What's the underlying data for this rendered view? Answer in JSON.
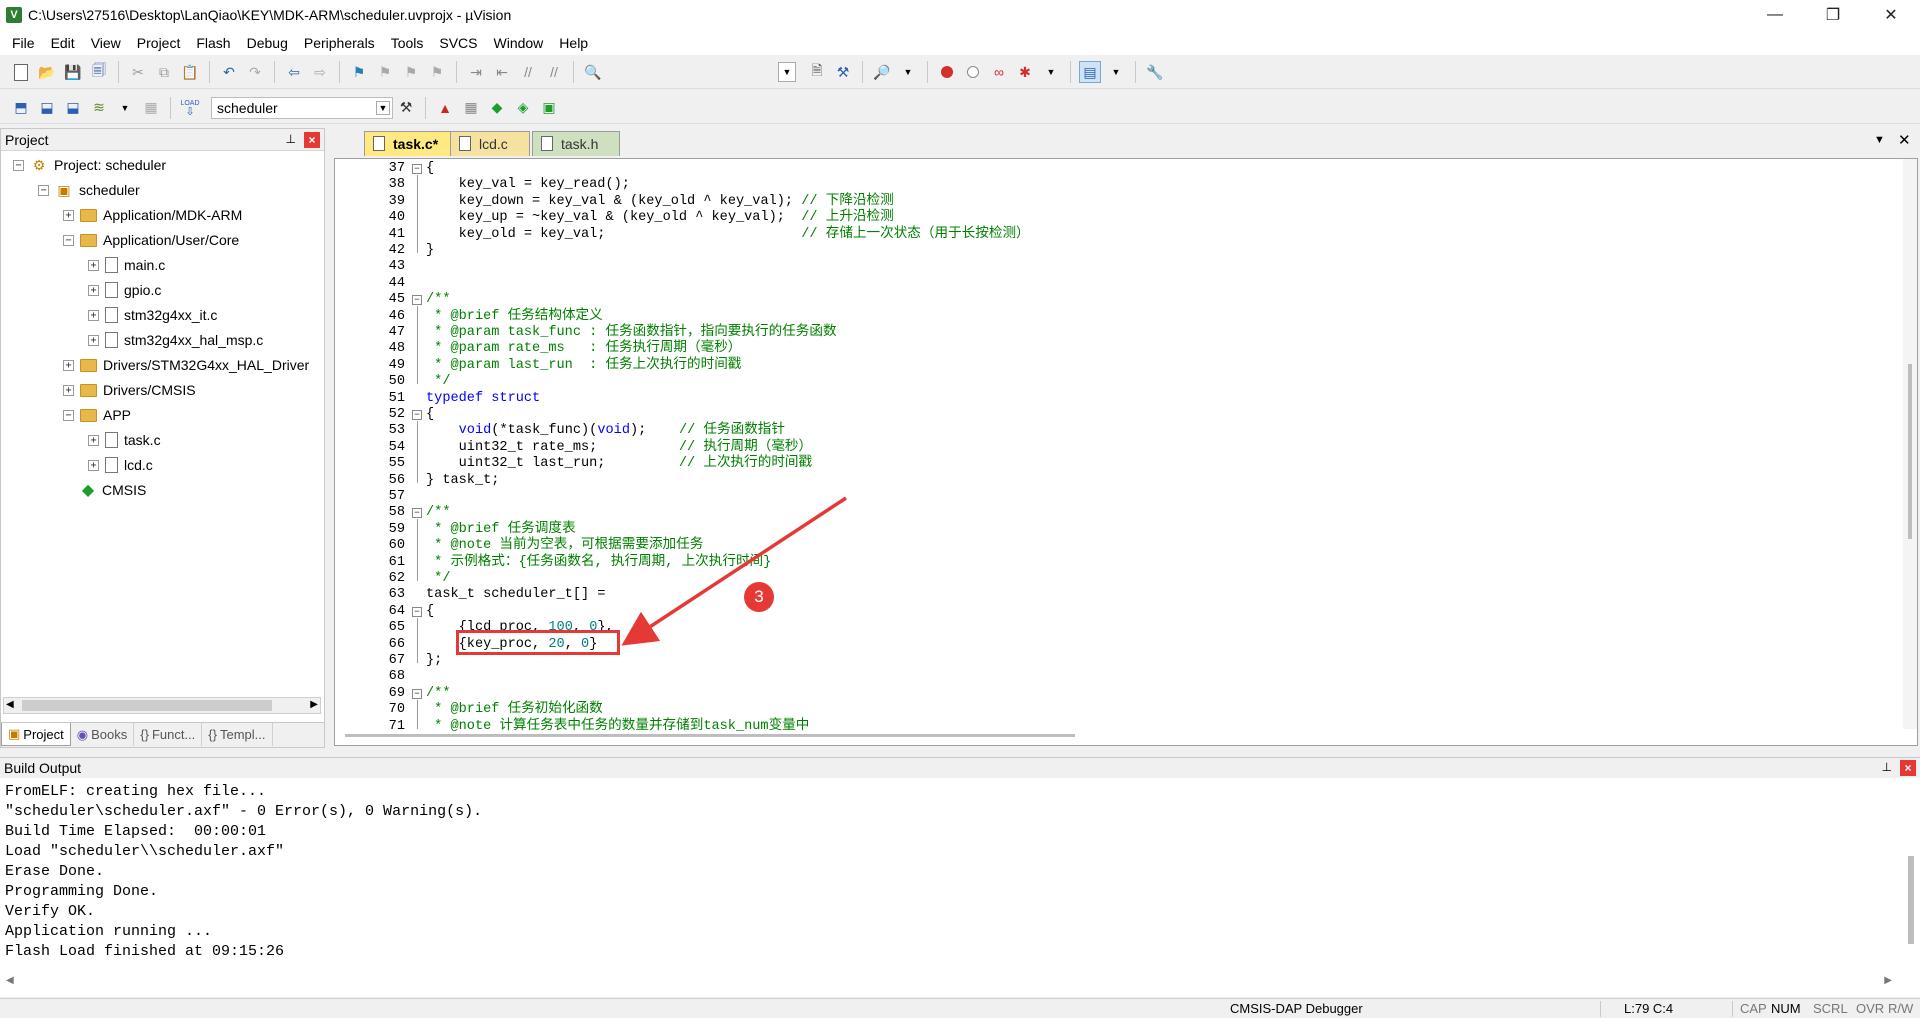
{
  "window": {
    "title": "C:\\Users\\27516\\Desktop\\LanQiao\\KEY\\MDK-ARM\\scheduler.uvprojx - µVision",
    "minimize": "—",
    "maximize": "❐",
    "close": "✕"
  },
  "menu": [
    "File",
    "Edit",
    "View",
    "Project",
    "Flash",
    "Debug",
    "Peripherals",
    "Tools",
    "SVCS",
    "Window",
    "Help"
  ],
  "toolbar2": {
    "target": "scheduler",
    "load_label": "LOAD"
  },
  "project_panel": {
    "title": "Project",
    "pin": "📌",
    "close": "✕",
    "tree": [
      {
        "label": "Project: scheduler",
        "level": 0,
        "expander": "−",
        "icon": "project-icon"
      },
      {
        "label": "scheduler",
        "level": 1,
        "expander": "−",
        "icon": "target-icon"
      },
      {
        "label": "Application/MDK-ARM",
        "level": 2,
        "expander": "+",
        "icon": "folder-icon"
      },
      {
        "label": "Application/User/Core",
        "level": 2,
        "expander": "−",
        "icon": "folder-icon"
      },
      {
        "label": "main.c",
        "level": 3,
        "expander": "+",
        "icon": "file-icon"
      },
      {
        "label": "gpio.c",
        "level": 3,
        "expander": "+",
        "icon": "file-icon"
      },
      {
        "label": "stm32g4xx_it.c",
        "level": 3,
        "expander": "+",
        "icon": "file-icon"
      },
      {
        "label": "stm32g4xx_hal_msp.c",
        "level": 3,
        "expander": "+",
        "icon": "file-icon"
      },
      {
        "label": "Drivers/STM32G4xx_HAL_Driver",
        "level": 2,
        "expander": "+",
        "icon": "folder-icon"
      },
      {
        "label": "Drivers/CMSIS",
        "level": 2,
        "expander": "+",
        "icon": "folder-icon"
      },
      {
        "label": "APP",
        "level": 2,
        "expander": "−",
        "icon": "folder-icon"
      },
      {
        "label": "task.c",
        "level": 3,
        "expander": "+",
        "icon": "file-icon"
      },
      {
        "label": "lcd.c",
        "level": 3,
        "expander": "+",
        "icon": "file-icon"
      },
      {
        "label": "CMSIS",
        "level": 2,
        "expander": "",
        "icon": "cmsis-icon"
      }
    ],
    "tabs": [
      {
        "label": "Project",
        "icon": "project-tab-icon",
        "active": true
      },
      {
        "label": "Books",
        "icon": "books-icon",
        "active": false
      },
      {
        "label": "Funct...",
        "icon": "functions-icon",
        "active": false
      },
      {
        "label": "Templ...",
        "icon": "templates-icon",
        "active": false
      }
    ]
  },
  "editor": {
    "tabs": [
      {
        "label": "task.c*",
        "active": true
      },
      {
        "label": "lcd.c",
        "active": false
      },
      {
        "label": "task.h",
        "active": false
      }
    ],
    "lines": [
      {
        "n": "37",
        "fold": "−",
        "code": "{"
      },
      {
        "n": "38",
        "fold": "",
        "code": "    key_val = key_read();"
      },
      {
        "n": "39",
        "fold": "",
        "code": "    key_down = key_val & (key_old ^ key_val); ",
        "comment": "// 下降沿检测"
      },
      {
        "n": "40",
        "fold": "",
        "code": "    key_up = ~key_val & (key_old ^ key_val);  ",
        "comment": "// 上升沿检测"
      },
      {
        "n": "41",
        "fold": "",
        "code": "    key_old = key_val;                        ",
        "comment": "// 存储上一次状态（用于长按检测）"
      },
      {
        "n": "42",
        "fold": "",
        "code": "}"
      },
      {
        "n": "43",
        "fold": "",
        "code": ""
      },
      {
        "n": "44",
        "fold": "",
        "code": ""
      },
      {
        "n": "45",
        "fold": "−",
        "code": "",
        "comment": "/**"
      },
      {
        "n": "46",
        "fold": "",
        "code": "",
        "comment": " * @brief 任务结构体定义"
      },
      {
        "n": "47",
        "fold": "",
        "code": "",
        "comment": " * @param task_func : 任务函数指针，指向要执行的任务函数"
      },
      {
        "n": "48",
        "fold": "",
        "code": "",
        "comment": " * @param rate_ms   : 任务执行周期（毫秒）"
      },
      {
        "n": "49",
        "fold": "",
        "code": "",
        "comment": " * @param last_run  : 任务上次执行的时间戳"
      },
      {
        "n": "50",
        "fold": "",
        "code": "",
        "comment": " */"
      },
      {
        "n": "51",
        "fold": "",
        "code": "",
        "keyword": "typedef struct"
      },
      {
        "n": "52",
        "fold": "−",
        "code": "{"
      },
      {
        "n": "53",
        "fold": "",
        "code": "    void(*task_func)(void);    ",
        "comment": "// 任务函数指针"
      },
      {
        "n": "54",
        "fold": "",
        "code": "    uint32_t rate_ms;          ",
        "comment": "// 执行周期（毫秒）"
      },
      {
        "n": "55",
        "fold": "",
        "code": "    uint32_t last_run;         ",
        "comment": "// 上次执行的时间戳"
      },
      {
        "n": "56",
        "fold": "",
        "code": "} task_t;"
      },
      {
        "n": "57",
        "fold": "",
        "code": ""
      },
      {
        "n": "58",
        "fold": "−",
        "code": "",
        "comment": "/**"
      },
      {
        "n": "59",
        "fold": "",
        "code": "",
        "comment": " * @brief 任务调度表"
      },
      {
        "n": "60",
        "fold": "",
        "code": "",
        "comment": " * @note 当前为空表，可根据需要添加任务"
      },
      {
        "n": "61",
        "fold": "",
        "code": "",
        "comment": " * 示例格式：{任务函数名, 执行周期, 上次执行时间}"
      },
      {
        "n": "62",
        "fold": "",
        "code": "",
        "comment": " */"
      },
      {
        "n": "63",
        "fold": "",
        "code": "task_t scheduler_t[] ="
      },
      {
        "n": "64",
        "fold": "−",
        "code": "{"
      },
      {
        "n": "65",
        "fold": "",
        "code": "    {lcd_proc, 100, 0},"
      },
      {
        "n": "66",
        "fold": "",
        "code": "    {key_proc, 20, 0}"
      },
      {
        "n": "67",
        "fold": "",
        "code": "};"
      },
      {
        "n": "68",
        "fold": "",
        "code": ""
      },
      {
        "n": "69",
        "fold": "−",
        "code": "",
        "comment": "/**"
      },
      {
        "n": "70",
        "fold": "",
        "code": "",
        "comment": " * @brief 任务初始化函数"
      },
      {
        "n": "71",
        "fold": "",
        "code": "",
        "comment": " * @note 计算任务表中任务的数量并存储到task_num变量中"
      }
    ],
    "annotation_number": "3"
  },
  "build_output": {
    "title": "Build Output",
    "lines": [
      "FromELF: creating hex file...",
      "\"scheduler\\scheduler.axf\" - 0 Error(s), 0 Warning(s).",
      "Build Time Elapsed:  00:00:01",
      "Load \"scheduler\\\\scheduler.axf\"",
      "Erase Done.",
      "Programming Done.",
      "Verify OK.",
      "Application running ...",
      "Flash Load finished at 09:15:26"
    ]
  },
  "statusbar": {
    "debugger": "CMSIS-DAP Debugger",
    "position": "L:79 C:4",
    "cap": "CAP",
    "num": "NUM",
    "scrl": "SCRL",
    "ovr": "OVR",
    "rw": "R/W"
  },
  "colors": {
    "keyword": "#0000ff",
    "comment": "#008000",
    "number": "#008080",
    "annotation_red": "#e53935",
    "active_tab": "#ffe980",
    "inactive_tab": "#f5e2a0"
  }
}
